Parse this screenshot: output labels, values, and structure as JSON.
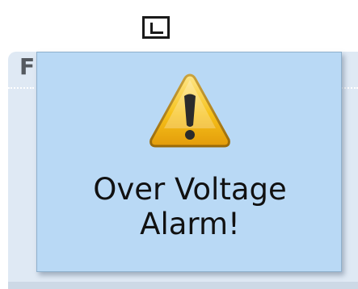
{
  "background_panel": {
    "title": "F"
  },
  "alarm": {
    "icon": "warning-icon",
    "line1": "Over Voltage",
    "line2": "Alarm!"
  },
  "colors": {
    "popup_background": "#b9d9f5",
    "panel_background": "#dfe9f4",
    "warning_yellow": "#f7c21a"
  }
}
